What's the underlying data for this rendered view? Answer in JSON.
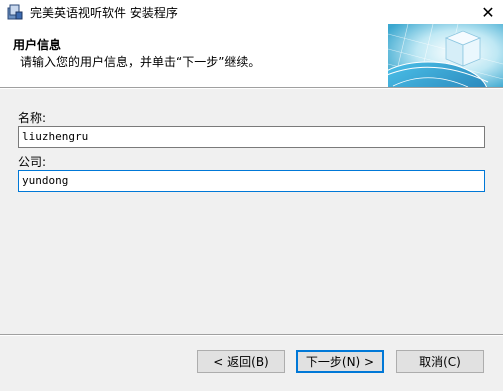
{
  "window": {
    "title": "完美英语视听软件 安装程序",
    "close_glyph": "✕"
  },
  "header": {
    "title": "用户信息",
    "subtitle": "请输入您的用户信息，并单击“下一步”继续。"
  },
  "form": {
    "name_label": "名称:",
    "name_value": "liuzhengru",
    "company_label": "公司:",
    "company_value": "yundong"
  },
  "buttons": {
    "back": "< 返回(B)",
    "next": "下一步(N) >",
    "cancel": "取消(C)"
  },
  "icons": {
    "app": "installer-icon",
    "header": "globe-cube-graphic"
  },
  "colors": {
    "focus_border": "#0078d7",
    "dialog_bg": "#f0f0f0"
  }
}
